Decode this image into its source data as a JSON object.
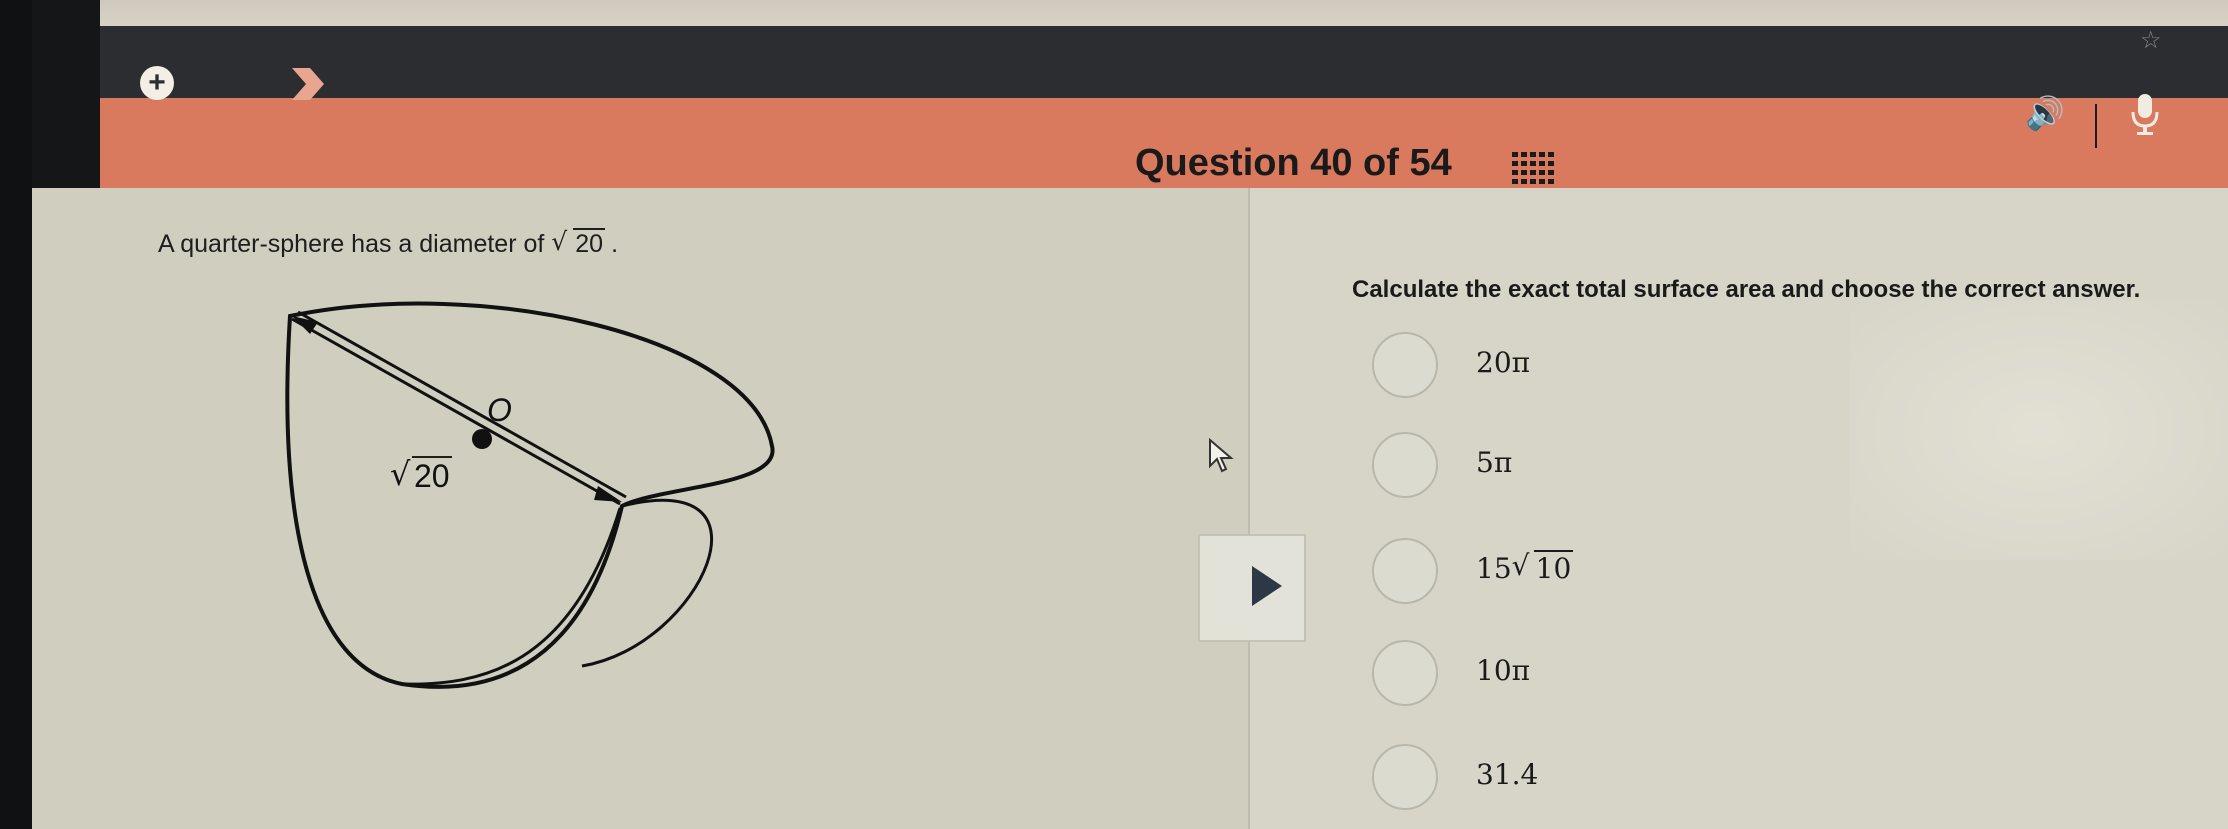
{
  "header": {
    "question_label": "Question 40 of 54"
  },
  "question": {
    "text": "A quarter-sphere has a diameter of",
    "radicand": "20",
    "end_punct": "."
  },
  "figure": {
    "label_radicand": "20",
    "center_label": "O"
  },
  "instruction": "Calculate the exact total surface area and choose the correct answer.",
  "choices": [
    {
      "text": "20π"
    },
    {
      "text": "5π"
    },
    {
      "coef": "15",
      "radicand": "10"
    },
    {
      "text": "10π"
    },
    {
      "text": "31.4"
    }
  ],
  "colors": {
    "header_bg": "#d97a5f",
    "toolbar_bg": "#2b2d30",
    "play_icon": "#2d3846"
  },
  "icons": [
    "plus-icon",
    "next-arrow-icon",
    "speaker-icon",
    "microphone-icon",
    "star-icon",
    "grid-icon",
    "play-icon",
    "mouse-cursor-icon"
  ]
}
